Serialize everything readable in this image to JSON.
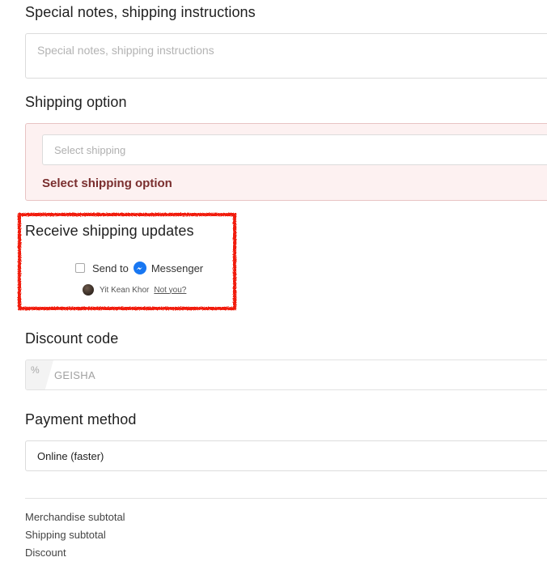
{
  "notes": {
    "title": "Special notes, shipping instructions",
    "placeholder": "Special notes, shipping instructions"
  },
  "shipping": {
    "title": "Shipping option",
    "select_placeholder": "Select shipping",
    "error": "Select shipping option"
  },
  "updates": {
    "title": "Receive shipping updates",
    "send_to": "Send to",
    "messenger": "Messenger",
    "user_name": "Yit Kean Khor",
    "not_you": "Not you?",
    "highlight_color": "#f11c0c"
  },
  "discount": {
    "title": "Discount code",
    "icon": "percent-icon",
    "value": "GEISHA"
  },
  "payment": {
    "title": "Payment method",
    "selected": "Online (faster)"
  },
  "summary": {
    "merch": "Merchandise subtotal",
    "shipping": "Shipping subtotal",
    "discount": "Discount"
  },
  "colors": {
    "error_bg": "#fdf1f1",
    "error_text": "#7a2e2e",
    "messenger_blue": "#1877f2"
  }
}
